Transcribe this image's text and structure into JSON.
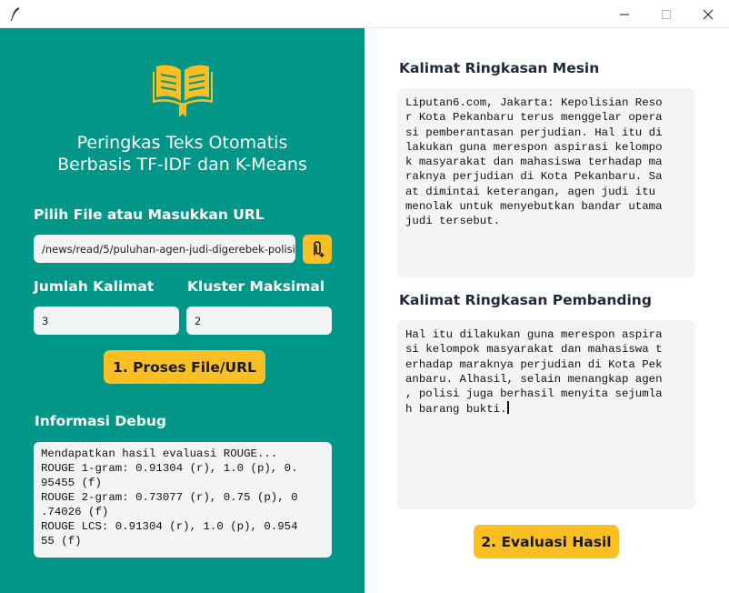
{
  "colors": {
    "panel": "#009788",
    "accent": "#fbbf24",
    "field": "#f3f4f6"
  },
  "window": {
    "icons": [
      "feather-icon",
      "minimize-icon",
      "maximize-icon",
      "close-icon"
    ]
  },
  "left": {
    "title_lines": [
      "Peringkas Teks Otomatis",
      "Berbasis TF-IDF dan K-Means"
    ],
    "file_label": "Pilih File atau Masukkan URL",
    "url_value": "/news/read/5/puluhan-agen-judi-digerebek-polisi",
    "sentences_label": "Jumlah Kalimat",
    "sentences_value": "3",
    "cluster_label": "Kluster Maksimal",
    "cluster_value": "2",
    "process_button": "1. Proses File/URL",
    "debug_label": "Informasi Debug",
    "debug_lines": [
      "Mendapatkan hasil evaluasi ROUGE...",
      "ROUGE 1-gram: 0.91304 (r), 1.0 (p), 0.",
      "95455 (f)",
      "ROUGE 2-gram: 0.73077 (r), 0.75 (p), 0",
      ".74026 (f)",
      "ROUGE LCS: 0.91304 (r), 1.0 (p), 0.954",
      "55 (f)"
    ]
  },
  "right": {
    "machine_label": "Kalimat Ringkasan Mesin",
    "machine_lines": [
      "Liputan6.com, Jakarta: Kepolisian Reso",
      "r Kota Pekanbaru terus menggelar opera",
      "si pemberantasan perjudian. Hal itu di",
      "lakukan guna merespon aspirasi kelompo",
      "k masyarakat dan mahasiswa terhadap ma",
      "raknya perjudian di Kota Pekanbaru. Sa",
      "at dimintai keterangan, agen judi itu",
      "menolak untuk menyebutkan bandar utama",
      "judi tersebut."
    ],
    "reference_label": "Kalimat Ringkasan Pembanding",
    "reference_lines": [
      "Hal itu dilakukan guna merespon aspira",
      "si kelompok masyarakat dan mahasiswa t",
      "erhadap maraknya perjudian di Kota Pek",
      "anbaru. Alhasil, selain menangkap agen",
      ", polisi juga berhasil menyita sejumla",
      "h barang bukti."
    ],
    "evaluate_button": "2. Evaluasi Hasil"
  }
}
